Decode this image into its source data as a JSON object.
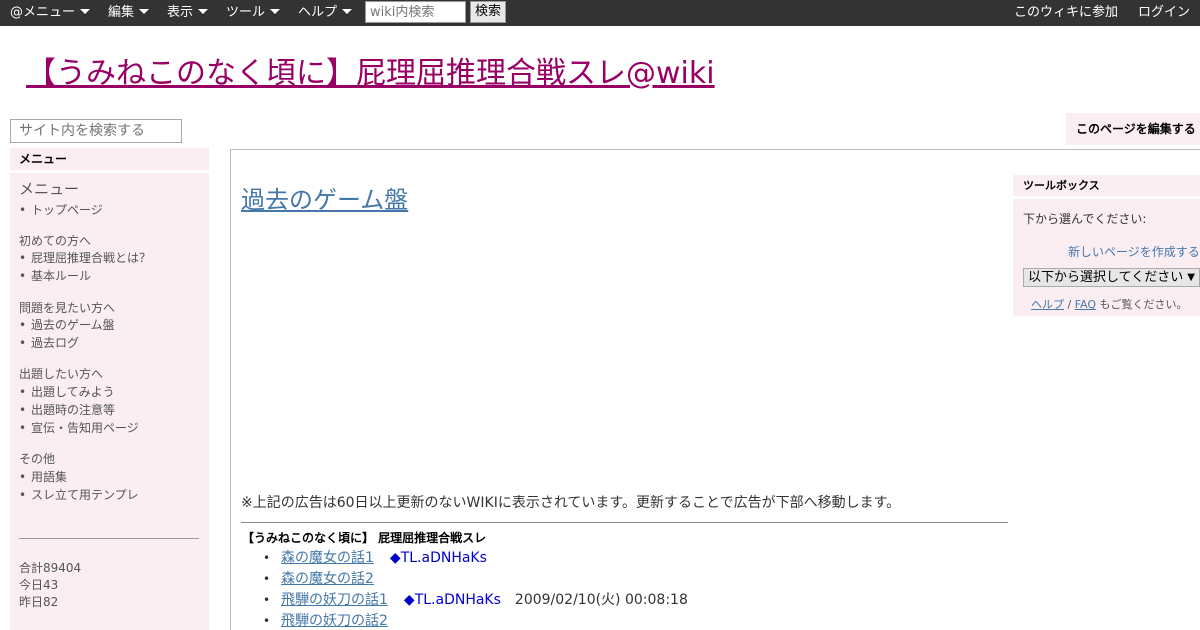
{
  "topbar": {
    "menus": [
      {
        "label": "@メニュー"
      },
      {
        "label": "編集"
      },
      {
        "label": "表示"
      },
      {
        "label": "ツール"
      },
      {
        "label": "ヘルプ"
      }
    ],
    "search_placeholder": "wiki内検索",
    "search_button": "検索",
    "join_label": "このウィキに参加",
    "login_label": "ログイン"
  },
  "site": {
    "title": "【うみねこのなく頃に】屁理屈推理合戦スレ@wiki"
  },
  "sidebar": {
    "search_placeholder": "サイト内を検索する",
    "menu_header": "メニュー",
    "menu_title": "メニュー",
    "top_item": "トップページ",
    "sections": [
      {
        "heading": "初めての方へ",
        "items": [
          "屁理屈推理合戦とは？",
          "基本ルール"
        ]
      },
      {
        "heading": "問題を見たい方へ",
        "items": [
          "過去のゲーム盤",
          "過去ログ"
        ]
      },
      {
        "heading": "出題したい方へ",
        "items": [
          "出題してみよう",
          "出題時の注意等",
          "宣伝・告知用ページ"
        ]
      },
      {
        "heading": "その他",
        "items": [
          "用語集",
          "スレ立て用テンプレ"
        ]
      }
    ],
    "bullet": "•",
    "counter": {
      "total": "合計89404",
      "today": "今日43",
      "yesterday": "昨日82"
    }
  },
  "edit_button": "このページを編集する",
  "main": {
    "page_title": "過去のゲーム盤",
    "ad_note": "※上記の広告は60日以上更新のないWIKIに表示されています。更新することで広告が下部へ移動します。",
    "section_heading": "【うみねこのなく頃に】 屁理屈推理合戦スレ",
    "bullet": "•",
    "entries": [
      {
        "title": "森の魔女の話1",
        "trip": "◆TL.aDNHaKs",
        "timestamp": ""
      },
      {
        "title": "森の魔女の話2",
        "trip": "",
        "timestamp": ""
      },
      {
        "title": "飛騨の妖刀の話1",
        "trip": "◆TL.aDNHaKs",
        "timestamp": "2009/02/10(火) 00:08:18"
      },
      {
        "title": "飛騨の妖刀の話2",
        "trip": "",
        "timestamp": ""
      }
    ]
  },
  "toolbox": {
    "header": "ツールボックス",
    "choose_label": "下から選んでください:",
    "new_page_link": "新しいページを作成する",
    "select_value": "以下から選択してください",
    "select_arrow": "▼",
    "help_link": "ヘルプ",
    "help_sep": " / ",
    "faq_link": "FAQ",
    "help_suffix": " もご覧ください。"
  },
  "colors": {
    "topbar_bg": "#333333",
    "title_link": "#990066",
    "link": "#4477aa",
    "trip": "#0000cc",
    "panel_bg": "#fbeef2"
  }
}
